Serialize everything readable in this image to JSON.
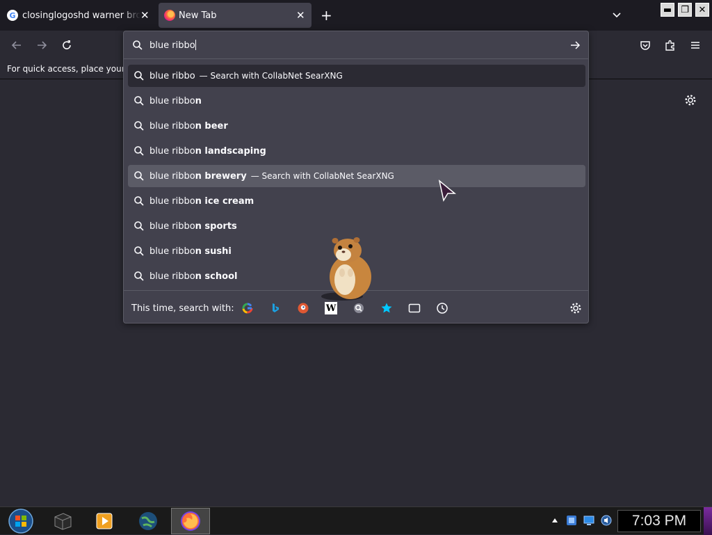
{
  "tabs": [
    {
      "title": "closinglogoshd warner bros pic",
      "close": "✕"
    },
    {
      "title": "New Tab",
      "close": "✕"
    }
  ],
  "window_controls": {
    "minimize": "▬",
    "restore": "❐",
    "close": "✕"
  },
  "bookmarks_bar": {
    "hint": "For quick access, place your boo"
  },
  "urlbar": {
    "value": "blue ribbo"
  },
  "results": [
    {
      "typed": "blue ribbo",
      "suggestion": "",
      "action": "— Search with CollabNet SearXNG"
    },
    {
      "typed": "blue ribbo",
      "suggestion": "n",
      "action": ""
    },
    {
      "typed": "blue ribbo",
      "suggestion": "n beer",
      "action": ""
    },
    {
      "typed": "blue ribbo",
      "suggestion": "n landscaping",
      "action": ""
    },
    {
      "typed": "blue ribbo",
      "suggestion": "n brewery",
      "action": "— Search with CollabNet SearXNG"
    },
    {
      "typed": "blue ribbo",
      "suggestion": "n ice cream",
      "action": ""
    },
    {
      "typed": "blue ribbo",
      "suggestion": "n sports",
      "action": ""
    },
    {
      "typed": "blue ribbo",
      "suggestion": "n sushi",
      "action": ""
    },
    {
      "typed": "blue ribbo",
      "suggestion": "n school",
      "action": ""
    }
  ],
  "one_off": {
    "label": "This time, search with:",
    "engines": [
      "google-icon",
      "bing-icon",
      "duckduckgo-icon",
      "wikipedia-icon",
      "searxng-icon",
      "bookmarks-icon",
      "tabs-icon",
      "history-icon"
    ],
    "wikipedia_glyph": "W"
  },
  "taskbar": {
    "clock": "7:03 PM"
  },
  "colors": {
    "accent": "#42414d",
    "selected_row": "#5b5b66",
    "background": "#2b2a33"
  }
}
